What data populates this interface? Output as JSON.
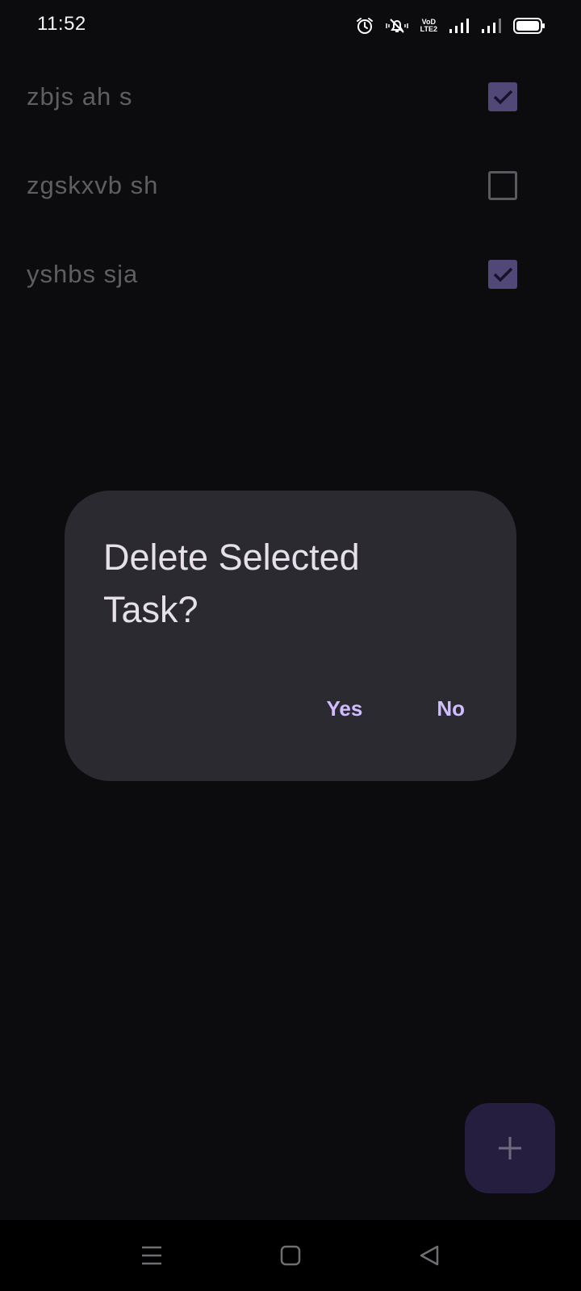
{
  "status_bar": {
    "time": "11:52",
    "icons": [
      "alarm-icon",
      "mute-icon",
      "volte-icon",
      "signal-icon",
      "signal-icon",
      "battery-icon"
    ],
    "volte_text": [
      "VoD",
      "LTE2"
    ]
  },
  "tasks": [
    {
      "label": "zbjs ah s",
      "checked": true
    },
    {
      "label": "zgskxvb sh",
      "checked": false
    },
    {
      "label": "yshbs sja",
      "checked": true
    }
  ],
  "dialog": {
    "title": "Delete Selected Task?",
    "yes_label": "Yes",
    "no_label": "No"
  },
  "fab": {
    "icon": "plus-icon"
  },
  "nav_bar": {
    "buttons": [
      "menu-icon",
      "home-icon",
      "back-icon"
    ]
  },
  "colors": {
    "background": "#0c0c0f",
    "dialog": "#2b2a31",
    "accent": "#cfbdfe",
    "checkbox_fill": "#514877",
    "fab": "#251e3f"
  }
}
